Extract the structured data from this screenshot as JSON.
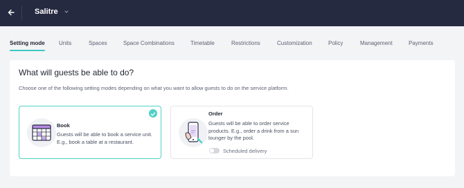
{
  "header": {
    "title": "Salitre",
    "back_icon": "arrow-left-icon",
    "dropdown_icon": "chevron-down-icon"
  },
  "tabs": [
    {
      "label": "Setting mode",
      "active": true
    },
    {
      "label": "Units"
    },
    {
      "label": "Spaces"
    },
    {
      "label": "Space Combinations"
    },
    {
      "label": "Timetable"
    },
    {
      "label": "Restrictions"
    },
    {
      "label": "Customization"
    },
    {
      "label": "Policy"
    },
    {
      "label": "Management"
    },
    {
      "label": "Payments"
    }
  ],
  "main": {
    "heading": "What will guests be able to do?",
    "description": "Choose one of the following setting modes depending on what you want to allow guests to do on the service platform.",
    "options": [
      {
        "title": "Book",
        "text": "Guests will be able to book a service unit. E.g., book a table at a restaurant.",
        "icon": "calendar-icon",
        "selected": true
      },
      {
        "title": "Order",
        "text": "Guests will be able to order service products. E.g., order a drink from a sun lounger by the pool.",
        "icon": "phone-order-icon",
        "selected": false,
        "toggle": {
          "label": "Scheduled delivery",
          "on": false
        }
      }
    ]
  },
  "colors": {
    "header_bg": "#262a41",
    "accent": "#4fd1c5",
    "page_bg": "#f3f4f6"
  }
}
